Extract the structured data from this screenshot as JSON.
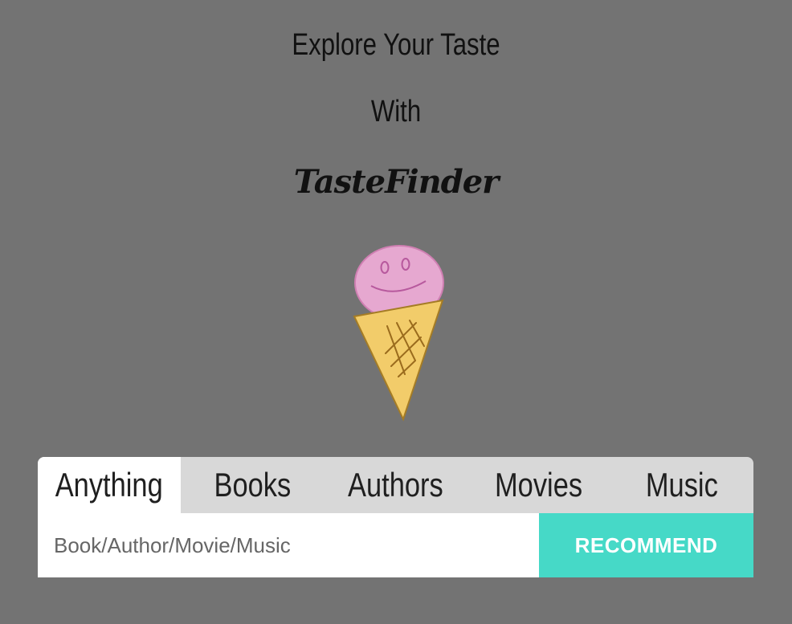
{
  "header": {
    "line1": "Explore Your Taste",
    "line2": "With",
    "brand": "TasteFinder"
  },
  "mascot": {
    "icon": "ice-cream-cone-icon",
    "scoop_color": "#e6a8d0",
    "cone_color": "#f2cc6a"
  },
  "tabs": [
    {
      "label": "Anything",
      "active": true
    },
    {
      "label": "Books",
      "active": false
    },
    {
      "label": "Authors",
      "active": false
    },
    {
      "label": "Movies",
      "active": false
    },
    {
      "label": "Music",
      "active": false
    }
  ],
  "search": {
    "value": "",
    "placeholder": "Book/Author/Movie/Music"
  },
  "button": {
    "label": "RECOMMEND"
  },
  "colors": {
    "background": "#737373",
    "tab_bar": "#d8d8d8",
    "active_tab": "#ffffff",
    "accent": "#46d9c7"
  }
}
